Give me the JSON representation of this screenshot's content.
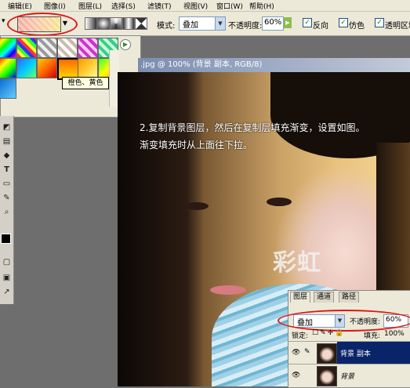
{
  "menubar": {
    "items": [
      "编辑(E)",
      "图像(I)",
      "图层(L)",
      "选择(S)",
      "滤镜(T)",
      "视图(V)",
      "窗口(W)",
      "帮助(H)"
    ]
  },
  "options": {
    "mode_label": "模式:",
    "mode_value": "叠加",
    "opacity_label": "不透明度:",
    "opacity_value": "60%",
    "reverse_label": "反向",
    "dither_label": "仿色",
    "transparency_label": "透明区域"
  },
  "picker": {
    "tooltip": "橙色、黄色"
  },
  "document": {
    "title": ".jpg @ 100% (背景 副本, RGB/8)",
    "instruction_line1": "2.复制背景图层，然后在复制层填充渐变，设置如图。",
    "instruction_line2": "渐变填充时从上面往下拉。",
    "watermark": "彩虹"
  },
  "layers": {
    "tabs": [
      "图层",
      "通道",
      "路径"
    ],
    "blend_mode": "叠加",
    "opacity_label": "不透明度:",
    "opacity_value": "60%",
    "lock_label": "锁定:",
    "fill_label": "填充:",
    "fill_value": "100%",
    "rows": [
      {
        "name": "背景 副本",
        "selected": true
      },
      {
        "name": "背景",
        "selected": false
      }
    ]
  },
  "colors": {
    "highlight_ring": "#e01515",
    "selected_layer": "#0a246a"
  },
  "icons": [
    "gradient-swatch",
    "dropdown-arrow",
    "linear-gradient-icon",
    "radial-gradient-icon",
    "eye-icon",
    "brush-icon",
    "lock-icon",
    "settings-arrow-icon"
  ]
}
